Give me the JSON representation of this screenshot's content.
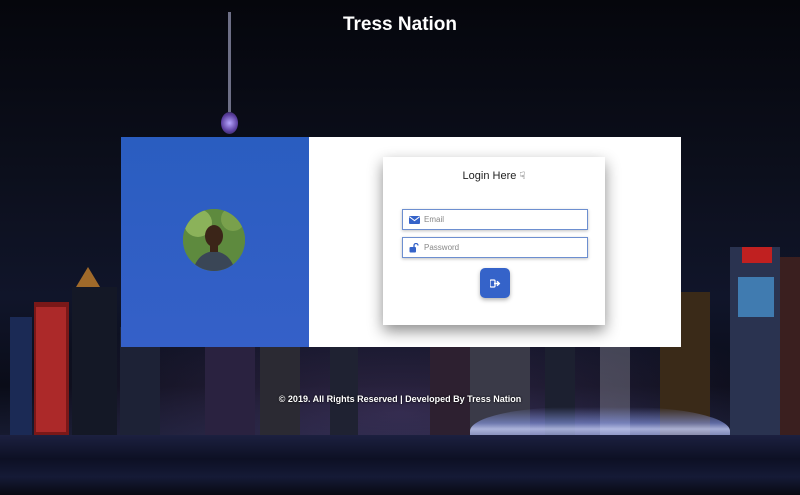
{
  "header": {
    "title": "Tress Nation"
  },
  "login": {
    "title": "Login Here",
    "title_icon": "hand-pointing-down-icon",
    "email_placeholder": "Email",
    "password_placeholder": "Password",
    "submit_icon": "sign-in-icon"
  },
  "footer": {
    "text": "© 2019. All Rights Reserved | Developed By Tress Nation"
  },
  "colors": {
    "accent": "#3563c9",
    "panel": "#2f5fc4",
    "white": "#ffffff"
  }
}
